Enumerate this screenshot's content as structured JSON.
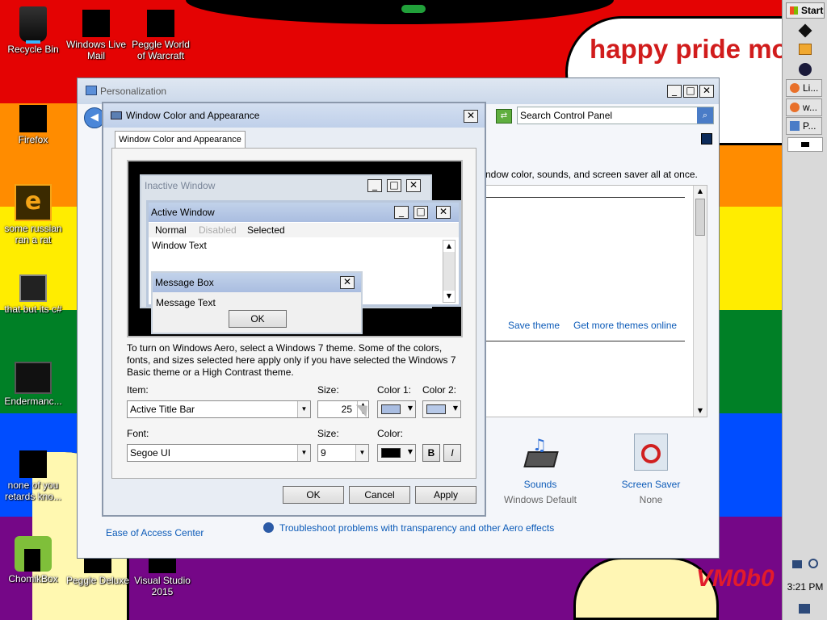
{
  "desktop": {
    "rainbow": [
      "#e40303",
      "#ff8c00",
      "#ffed00",
      "#008026",
      "#004dff",
      "#750787"
    ],
    "banner_text": "happy pride mo",
    "watermark": "VM0b0",
    "icons": [
      {
        "label": "Recycle Bin"
      },
      {
        "label": "Windows Live Mail"
      },
      {
        "label": "Peggle World of Warcraft"
      },
      {
        "label": "Firefox"
      },
      {
        "label": "some russian ran a rat"
      },
      {
        "label": "that but its c#"
      },
      {
        "label": "Endermanc..."
      },
      {
        "label": "none of you retards kno..."
      },
      {
        "label": "ChomikBox"
      },
      {
        "label": "Peggle Deluxe"
      },
      {
        "label": "Visual Studio 2015"
      }
    ]
  },
  "taskbar": {
    "start_label": "Start",
    "items": [
      "Li...",
      "w...",
      "P..."
    ],
    "clock": "3:21 PM"
  },
  "personalization": {
    "title": "Personalization",
    "search_placeholder": "Search Control Panel",
    "intro_text": "ndow color, sounds, and screen saver all at once.",
    "save_theme": "Save theme",
    "get_more_themes": "Get more themes online",
    "sounds_label": "Sounds",
    "sounds_value": "Windows Default",
    "screensaver_label": "Screen Saver",
    "screensaver_value": "None",
    "ease_of_access": "Ease of Access Center",
    "troubleshoot": "Troubleshoot problems with transparency and other Aero effects"
  },
  "dialog": {
    "title": "Window Color and Appearance",
    "tab": "Window Color and Appearance",
    "preview": {
      "inactive_title": "Inactive Window",
      "active_title": "Active Window",
      "menu_normal": "Normal",
      "menu_disabled": "Disabled",
      "menu_selected": "Selected",
      "window_text": "Window Text",
      "msgbox_title": "Message Box",
      "msgbox_text": "Message Text",
      "msgbox_ok": "OK"
    },
    "info_text": "To turn on Windows Aero, select a Windows 7 theme.  Some of the colors, fonts, and sizes selected here apply only if you have selected the Windows 7 Basic theme or a High Contrast theme.",
    "item_label": "Item:",
    "item_value": "Active Title Bar",
    "size_label": "Size:",
    "item_size": "25",
    "color1_label": "Color 1:",
    "color2_label": "Color 2:",
    "color1": "#a9bde1",
    "color2": "#b7c9e8",
    "font_label": "Font:",
    "font_value": "Segoe UI",
    "font_size_label": "Size:",
    "font_size": "9",
    "font_color_label": "Color:",
    "font_color": "#000000",
    "bold": "B",
    "italic": "I",
    "ok": "OK",
    "cancel": "Cancel",
    "apply": "Apply"
  }
}
